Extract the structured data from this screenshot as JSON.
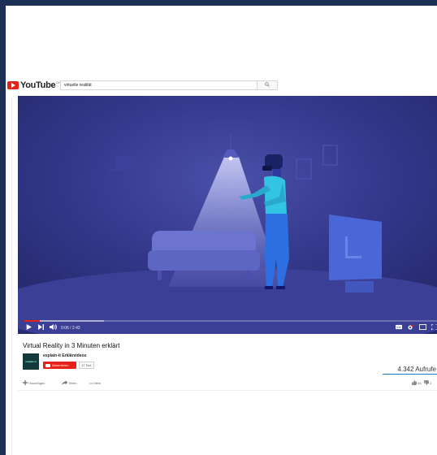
{
  "header": {
    "logo_text": "YouTube",
    "logo_region": "DE",
    "search_value": "virtuelle realität",
    "search_icon": "search-icon"
  },
  "player": {
    "time": "0:06 / 2:42",
    "progress_played": 0.037,
    "progress_buffered": 0.19,
    "controls": [
      "play-icon",
      "next-icon",
      "volume-icon",
      "subtitles-icon",
      "settings-icon",
      "miniplayer-icon",
      "fullscreen-icon"
    ],
    "colors": {
      "background": "#2a2d78",
      "accent": "#e62117"
    }
  },
  "video": {
    "title": "Virtual Reality in 3 Minuten erklärt",
    "channel_name": "explain-it Erklärvideos",
    "avatar_text": "explain-it",
    "subscribe_label": "Abonnieren",
    "subscriber_count": "17 Tsd.",
    "views": "4.342 Aufrufe"
  },
  "actions": {
    "add_label": "Hinzufügen",
    "share_label": "Teilen",
    "more_label": "Mehr",
    "likes": "56",
    "dislikes": "2"
  }
}
